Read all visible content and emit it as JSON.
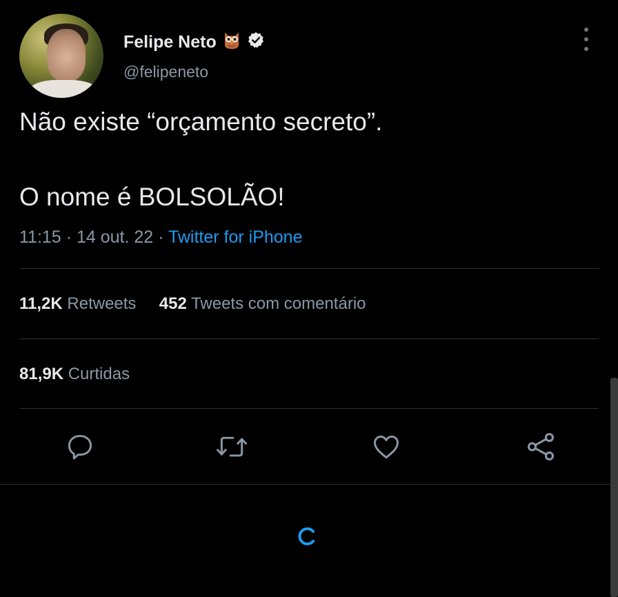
{
  "user": {
    "display_name": "Felipe Neto",
    "handle": "@felipeneto",
    "name_emoji_icon": "owl-emoji-icon",
    "verified_icon": "verified-badge-icon"
  },
  "tweet": {
    "line1": "Não existe “orçamento secreto”.",
    "line2": "O nome é BOLSOLÃO!",
    "time": "11:15",
    "date": "14 out. 22",
    "source": "Twitter for iPhone"
  },
  "stats": {
    "retweets_count": "11,2K",
    "retweets_label": "Retweets",
    "quotes_count": "452",
    "quotes_label": "Tweets com comentário",
    "likes_count": "81,9K",
    "likes_label": "Curtidas"
  },
  "actions": [
    "reply-icon",
    "retweet-icon",
    "like-icon",
    "share-icon"
  ],
  "colors": {
    "background": "#000000",
    "text": "#e7e9ea",
    "secondary": "#8b98a5",
    "accent": "#1d9bf0",
    "divider": "#2f3336"
  }
}
